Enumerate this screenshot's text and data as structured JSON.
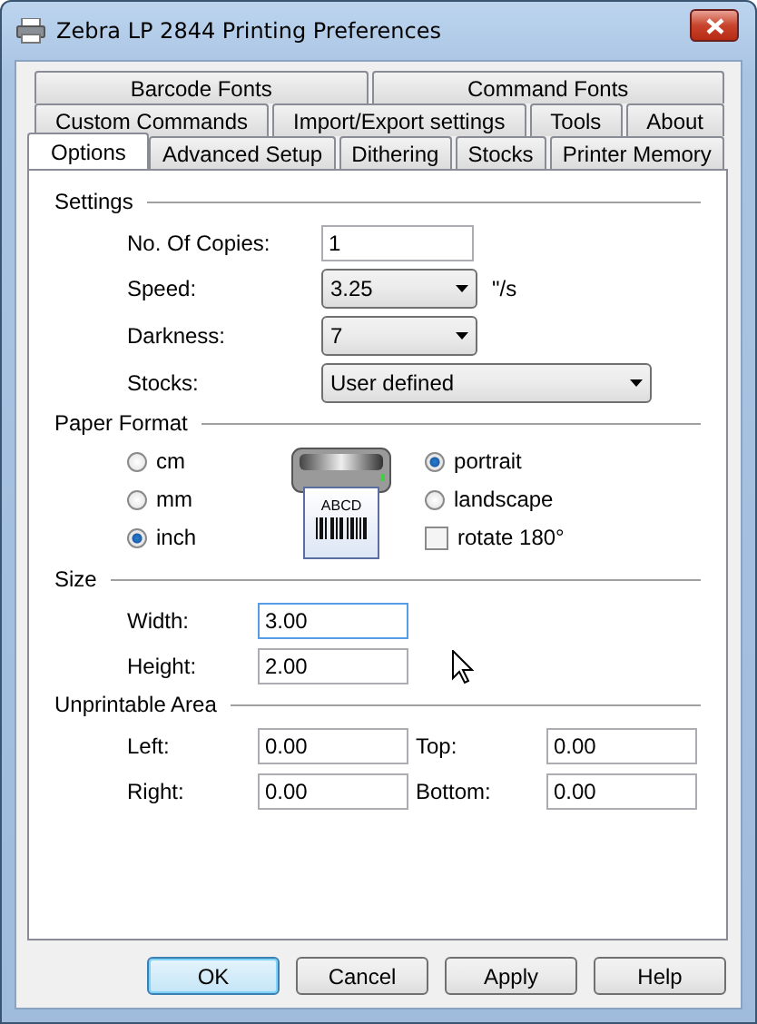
{
  "window": {
    "title": "Zebra LP 2844 Printing Preferences"
  },
  "tab_rows": [
    [
      {
        "label": "Barcode Fonts",
        "selected": false
      },
      {
        "label": "Command Fonts",
        "selected": false
      }
    ],
    [
      {
        "label": "Custom Commands",
        "selected": false
      },
      {
        "label": "Import/Export settings",
        "selected": false
      },
      {
        "label": "Tools",
        "selected": false
      },
      {
        "label": "About",
        "selected": false
      }
    ],
    [
      {
        "label": "Options",
        "selected": true
      },
      {
        "label": "Advanced Setup",
        "selected": false
      },
      {
        "label": "Dithering",
        "selected": false
      },
      {
        "label": "Stocks",
        "selected": false
      },
      {
        "label": "Printer Memory",
        "selected": false
      }
    ]
  ],
  "settings": {
    "title": "Settings",
    "fields": [
      {
        "kind": "text",
        "label": "No. Of Copies:",
        "value": "1"
      },
      {
        "kind": "select",
        "label": "Speed:",
        "value": "3.25",
        "unit": "\"/s"
      },
      {
        "kind": "select",
        "label": "Darkness:",
        "value": "7"
      },
      {
        "kind": "wide-select",
        "label": "Stocks:",
        "value": "User defined"
      }
    ]
  },
  "paper_format": {
    "title": "Paper Format",
    "units": [
      {
        "label": "cm",
        "selected": false
      },
      {
        "label": "mm",
        "selected": false
      },
      {
        "label": "inch",
        "selected": true
      }
    ],
    "label_text": "ABCD",
    "orientations": [
      {
        "label": "portrait",
        "selected": true
      },
      {
        "label": "landscape",
        "selected": false
      }
    ],
    "rotate": {
      "label": "rotate 180°",
      "checked": false
    }
  },
  "size": {
    "title": "Size",
    "fields": [
      {
        "label": "Width:",
        "value": "3.00",
        "focused": true
      },
      {
        "label": "Height:",
        "value": "2.00",
        "focused": false
      }
    ]
  },
  "unprintable": {
    "title": "Unprintable Area",
    "fields": [
      {
        "label": "Left:",
        "value": "0.00"
      },
      {
        "label": "Top:",
        "value": "0.00"
      },
      {
        "label": "Right:",
        "value": "0.00"
      },
      {
        "label": "Bottom:",
        "value": "0.00"
      }
    ]
  },
  "buttons": [
    {
      "label": "OK",
      "default": true
    },
    {
      "label": "Cancel",
      "default": false
    },
    {
      "label": "Apply",
      "default": false
    },
    {
      "label": "Help",
      "default": false
    }
  ]
}
